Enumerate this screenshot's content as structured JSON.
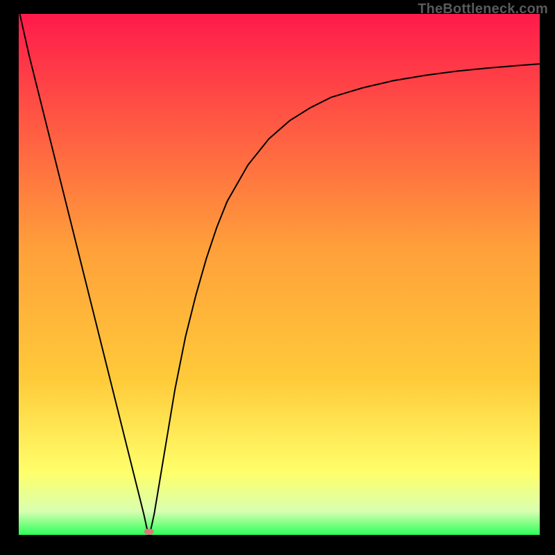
{
  "watermark": "TheBottleneck.com",
  "chart_data": {
    "type": "line",
    "title": "",
    "xlabel": "",
    "ylabel": "",
    "x_range": [
      0,
      100
    ],
    "y_range": [
      0,
      100
    ],
    "axes_visible": false,
    "grid": false,
    "background_gradient": {
      "top_color": "#ff1a4b",
      "mid_color": "#ffca3a",
      "lower_color": "#ffff6a",
      "bottom_color": "#2dff5a"
    },
    "series": [
      {
        "name": "bottleneck-curve",
        "color": "#000000",
        "stroke_width": 2,
        "x": [
          0.2,
          2,
          4,
          6,
          8,
          10,
          12,
          14,
          16,
          18,
          20,
          22,
          23,
          24,
          24.7,
          25.3,
          26,
          27,
          28,
          30,
          32,
          34,
          36,
          38,
          40,
          44,
          48,
          52,
          56,
          60,
          66,
          72,
          78,
          84,
          90,
          96,
          100
        ],
        "y": [
          100,
          92,
          84,
          76,
          68,
          60,
          52,
          44,
          36,
          28,
          20,
          12,
          8,
          4,
          0.8,
          0.8,
          4,
          10,
          16,
          28,
          38,
          46,
          53,
          59,
          64,
          71,
          76,
          79.5,
          82,
          84,
          85.8,
          87.2,
          88.2,
          89,
          89.6,
          90.1,
          90.4
        ]
      }
    ],
    "marker": {
      "name": "min-point",
      "x": 25,
      "y": 0.6,
      "color": "#d87a7a",
      "rx": 7,
      "ry": 4.5
    }
  }
}
